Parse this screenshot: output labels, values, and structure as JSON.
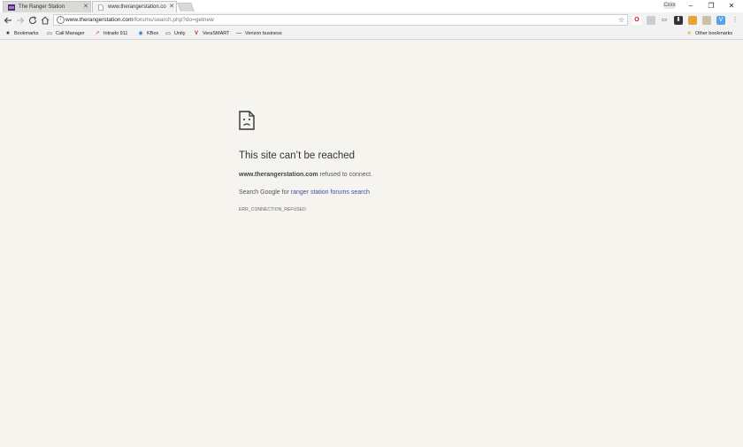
{
  "tabs": [
    {
      "title": "The Ranger Station",
      "active": false
    },
    {
      "title": "www.therangerstation.co",
      "active": true
    }
  ],
  "window": {
    "profile_label": "Cxxx",
    "minimize": "–",
    "restore": "❐",
    "close": "✕"
  },
  "address_bar": {
    "domain": "www.therangerstation.com",
    "path": "/forums/search.php?do=getnew"
  },
  "bookmarks": {
    "items": [
      {
        "label": "Bookmarks",
        "icon": "star-icon"
      },
      {
        "label": "Call Manager",
        "icon": "people-icon"
      },
      {
        "label": "Intrado 911",
        "icon": "arrow-icon"
      },
      {
        "label": "KBox",
        "icon": "kbox-icon"
      },
      {
        "label": "Unity",
        "icon": "people-icon"
      },
      {
        "label": "VeraSMART",
        "icon": "vs-icon"
      },
      {
        "label": "Verizon business",
        "icon": "dash-icon"
      }
    ],
    "other": "Other bookmarks"
  },
  "error": {
    "title": "This site can’t be reached",
    "host": "www.therangerstation.com",
    "message": " refused to connect.",
    "search_prefix": "Search Google for ",
    "search_link": "ranger station forums search",
    "code": "ERR_CONNECTION_REFUSED"
  },
  "colors": {
    "background": "#f6f4ef",
    "link": "#3e4fa2",
    "tab_inactive": "#dad9d5"
  }
}
